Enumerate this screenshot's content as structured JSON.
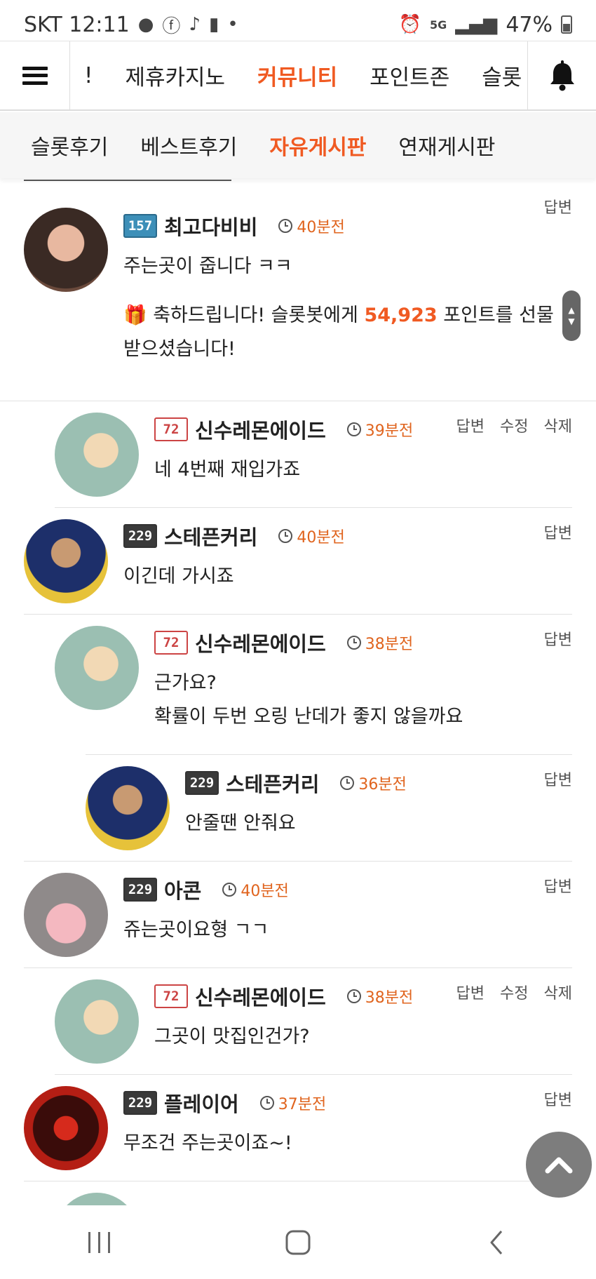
{
  "status_bar": {
    "carrier_time": "SKT 12:11",
    "battery": "47%",
    "network": "5G"
  },
  "top_nav": {
    "items": [
      "!",
      "제휴카지노",
      "커뮤니티",
      "포인트존",
      "슬롯"
    ],
    "active_index": 2
  },
  "sub_nav": {
    "items": [
      "슬롯후기",
      "베스트후기",
      "자유게시판",
      "연재게시판"
    ],
    "active_index": 2
  },
  "actions": {
    "reply": "답변",
    "edit": "수정",
    "delete": "삭제"
  },
  "comments": [
    {
      "username": "최고다비비",
      "level_badge": "157",
      "time": "40분전",
      "text": "주는곳이 줍니다 ㅋㅋ",
      "gift": {
        "prefix": "축하드립니다! 슬롯봇에게 ",
        "points": "54,923",
        "suffix": " 포인트를 선물 받으셨습니다!"
      }
    },
    {
      "username": "신수레몬에이드",
      "level_badge": "72",
      "time": "39분전",
      "text": "네 4번째 재입가죠"
    },
    {
      "username": "스테픈커리",
      "level_badge": "229",
      "time": "40분전",
      "text": "이긴데 가시죠"
    },
    {
      "username": "신수레몬에이드",
      "level_badge": "72",
      "time": "38분전",
      "text_lines": [
        "근가요?",
        "확률이 두번 오링 난데가 좋지 않을까요"
      ]
    },
    {
      "username": "스테픈커리",
      "level_badge": "229",
      "time": "36분전",
      "text": "안줄땐 안줘요"
    },
    {
      "username": "아콘",
      "level_badge": "229",
      "time": "40분전",
      "text": "쥬는곳이요형 ㄱㄱ"
    },
    {
      "username": "신수레몬에이드",
      "level_badge": "72",
      "time": "38분전",
      "text": "그곳이 맛집인건가?"
    },
    {
      "username": "플레이어",
      "level_badge": "229",
      "time": "37분전",
      "text": "무조건 주는곳이죠~!"
    }
  ],
  "colors": {
    "accent": "#f05a22",
    "time": "#e0641e"
  }
}
